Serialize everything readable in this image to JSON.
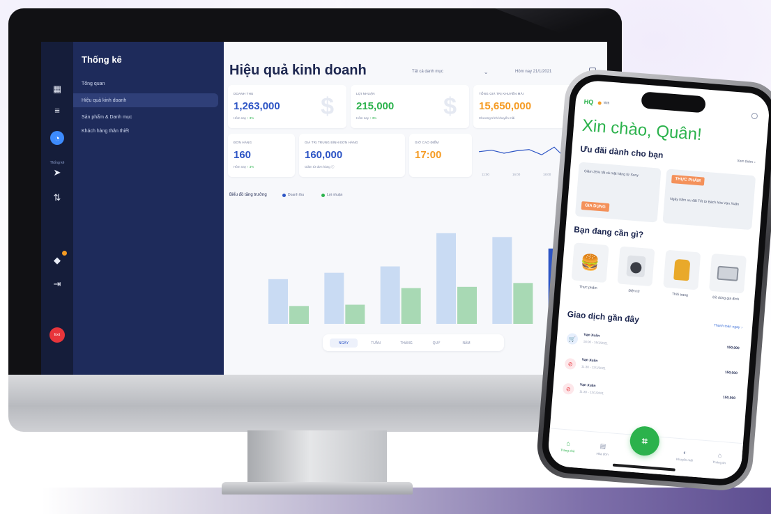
{
  "desktop": {
    "sidebar": {
      "title": "Thống kê",
      "items": [
        {
          "label": "Tổng quan",
          "active": false
        },
        {
          "label": "Hiệu quả kinh doanh",
          "active": true
        },
        {
          "label": "Sản phẩm & Danh mục",
          "active": false
        },
        {
          "label": "Khách hàng thân thiết",
          "active": false
        }
      ]
    },
    "rail": {
      "icons": [
        "grid-icon",
        "database-icon",
        "stats-icon",
        "send-icon",
        "filter-icon",
        "shop-icon",
        "logout-icon"
      ],
      "active_caption": "Thống kê",
      "alert_label": "Exit"
    },
    "header": {
      "title": "Hiệu quả kinh doanh",
      "category_filter": "Tất cả danh mục",
      "date_filter": "Hôm nay 21/1/2021"
    },
    "kpis": [
      {
        "label": "DOANH THU",
        "value": "1,263,000",
        "sub_prefix": "Hôm nay",
        "sub_change": "↑ 3%",
        "color": "#2d55c5"
      },
      {
        "label": "LỢI NHUẬN",
        "value": "215,000",
        "sub_prefix": "Hôm nay",
        "sub_change": "↑ 3%",
        "color": "#2bb24c"
      },
      {
        "label": "TỔNG GIÁ TRỊ KHUYẾN MÃI",
        "value": "15,650,000",
        "sub_prefix": "Chương trình khuyến mãi",
        "sub_change": "",
        "color": "#f59b23"
      }
    ],
    "stats": [
      {
        "label": "ĐƠN HÀNG",
        "value": "160",
        "sub_prefix": "Hôm nay",
        "sub_change": "↑ 3%",
        "color": "#2d55c5"
      },
      {
        "label": "GIÁ TRỊ TRUNG BÌNH ĐƠN HÀNG",
        "value": "160,000",
        "sub_prefix": "Giảm từ đơn hàng",
        "sub_change": "",
        "color": "#2d55c5"
      },
      {
        "label": "GIỜ CAO ĐIỂM",
        "value": "17:00",
        "sub_prefix": "",
        "sub_change": "",
        "color": "#f59b23"
      }
    ],
    "peak_hours": {
      "x_labels": [
        "11:00",
        "16:00",
        "18:00",
        "22:00"
      ],
      "values": [
        0.55,
        0.6,
        0.5,
        0.58,
        0.62,
        0.45,
        0.7,
        0.3,
        0.2,
        0.55,
        0.6
      ]
    },
    "growth_chart_title": "Biểu đồ tăng trưởng",
    "period_tabs": [
      {
        "label": "NGÀY",
        "active": true
      },
      {
        "label": "TUẦN",
        "active": false
      },
      {
        "label": "THÁNG",
        "active": false
      },
      {
        "label": "QUÝ",
        "active": false
      },
      {
        "label": "NĂM",
        "active": false
      }
    ],
    "colors": {
      "primary": "#1e2b5b",
      "revenue": "#2d55c5",
      "profit": "#2bb24c",
      "accent": "#f59b23"
    }
  },
  "chart_data": {
    "type": "bar",
    "title": "Biểu đồ tăng trưởng",
    "categories": [
      "",
      "",
      "",
      "",
      "",
      ""
    ],
    "series": [
      {
        "name": "Doanh thu",
        "values": [
          1.75,
          2.0,
          2.25,
          3.55,
          3.4,
          2.95
        ]
      },
      {
        "name": "Lợi nhuận",
        "values": [
          0.7,
          0.75,
          1.4,
          1.45,
          1.6,
          1.2
        ]
      }
    ],
    "ylim": [
      0,
      4.5
    ],
    "y_ticks": [
      "",
      "",
      "",
      "",
      "",
      ""
    ],
    "highlight_index": 5,
    "grid": false,
    "legend": "top-left"
  },
  "mobile": {
    "brand": "HQ",
    "badge_text": "Wifi",
    "greeting": "Xin chào, Quân!",
    "offers_title": "Ưu đãi dành cho bạn",
    "offers_link": "Xem thêm",
    "offers": [
      {
        "text": "Giảm 35% tất cả mặt hàng từ Sony",
        "tag": "GIA DỤNG"
      },
      {
        "text": "Ngày trăm ưu đãi Tết từ Bách hóa Vạn Xuân",
        "tag": "THỰC PHẨM"
      }
    ],
    "categories_title": "Bạn đang cần gì?",
    "categories": [
      {
        "label": "Thực phẩm",
        "icon": "burger-icon"
      },
      {
        "label": "Điện tử",
        "icon": "washer-icon"
      },
      {
        "label": "Thời trang",
        "icon": "jacket-icon"
      },
      {
        "label": "Đồ dùng gia đình",
        "icon": "tools-icon"
      }
    ],
    "transactions_title": "Giao dịch gần đây",
    "transactions_link": "Thanh toán ngay",
    "transactions": [
      {
        "name": "Vạn Xuân",
        "time": "18:00 - 15/1/2021",
        "amount": "150,000",
        "icon": "cart-icon"
      },
      {
        "name": "Vạn Xuân",
        "time": "11:30 - 12/1/2021",
        "amount": "150,000",
        "icon": "tag-icon"
      },
      {
        "name": "Vạn Xuân",
        "time": "11:30 - 12/1/2021",
        "amount": "150,000",
        "icon": "tag-icon"
      }
    ],
    "bottom_nav": [
      {
        "label": "Trang chủ",
        "icon": "home-icon",
        "active": true
      },
      {
        "label": "Hóa đơn",
        "icon": "receipt-icon",
        "active": false
      },
      {
        "label": "Khuyến mãi",
        "icon": "promo-icon",
        "active": false
      },
      {
        "label": "Thông tin",
        "icon": "profile-icon",
        "active": false
      }
    ]
  }
}
